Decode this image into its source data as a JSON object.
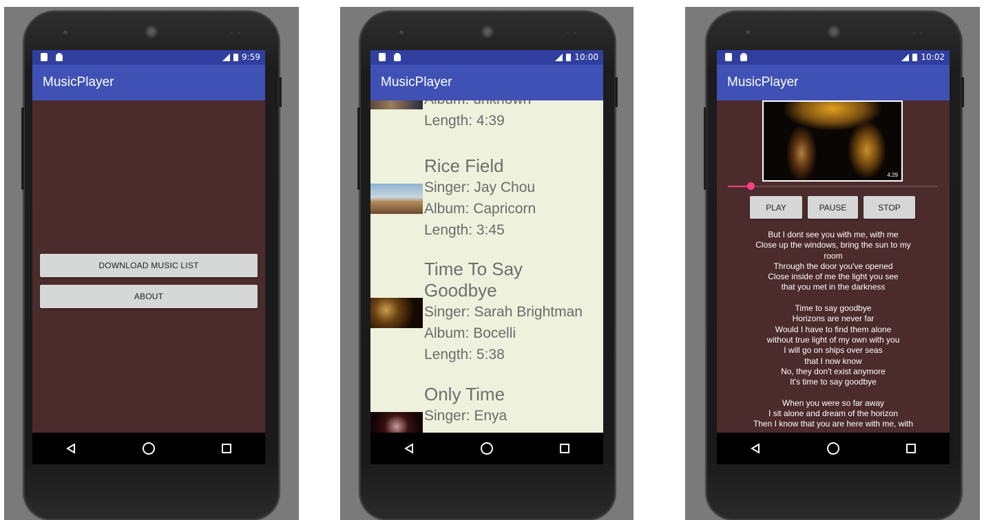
{
  "app_title": "MusicPlayer",
  "screens": [
    {
      "status_time": "9:59",
      "buttons": {
        "download": "DOWNLOAD MUSIC LIST",
        "about": "ABOUT"
      }
    },
    {
      "status_time": "10:00",
      "songs": [
        {
          "title": "",
          "singer": "",
          "album": "Album: unknown",
          "length": "Length: 4:39"
        },
        {
          "title": "Rice Field",
          "singer": "Singer: Jay Chou",
          "album": "Album: Capricorn",
          "length": "Length: 3:45"
        },
        {
          "title_line1": "Time To Say",
          "title_line2": "Goodbye",
          "singer": "Singer: Sarah Brightman",
          "album": "Album: Bocelli",
          "length": "Length: 5:38"
        },
        {
          "title": "Only Time",
          "singer": "Singer: Enya"
        }
      ]
    },
    {
      "status_time": "10:02",
      "video_duration": "4:29",
      "seek_progress": 0.11,
      "controls": {
        "play": "PLAY",
        "pause": "PAUSE",
        "stop": "STOP"
      },
      "lyrics": "But I dont see you with me, with me\nClose up the windows, bring the sun to my\nroom\nThrough the door you've opened\nClose inside of me the light you see\nthat you met in the darkness\n\nTime to say goodbye\nHorizons are never far\nWould I have to find them alone\nwithout true light of my own with you\nI will go on ships over seas\nthat I now know\nNo, they don't exist anymore\nIt's time to say goodbye\n\nWhen you were so far away\nI sit alone and dream of the horizon\nThen I know that you are here with me, with"
    }
  ],
  "colors": {
    "status_bar": "#303f9f",
    "toolbar": "#3f51b5",
    "dark_background": "#4c2b2c",
    "list_background": "#eef1dc",
    "accent": "#ff4081"
  },
  "icons": [
    "sd-card-icon",
    "android-icon",
    "lte-signal-icon",
    "battery-icon",
    "back-icon",
    "home-icon",
    "recents-icon"
  ]
}
